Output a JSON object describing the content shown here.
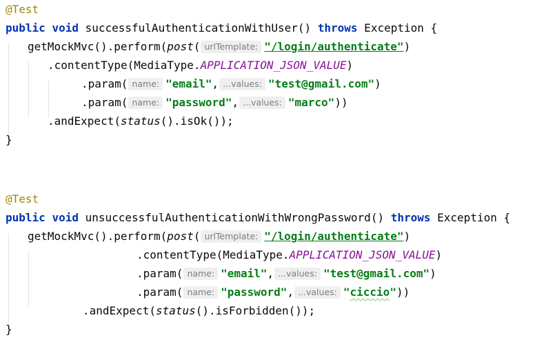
{
  "code": {
    "test1": {
      "annotation": "@Test",
      "kw_public": "public",
      "kw_void": "void",
      "method_sig": " successfulAuthenticationWithUser() ",
      "kw_throws": "throws",
      "sig_tail": " Exception {",
      "perform_pre": "getMockMvc().perform(",
      "post": "post",
      "paren": "(",
      "hint_url": "urlTemplate:",
      "url": "\"/login/authenticate\"",
      "close_paren": ")",
      "content_type_pre": ".contentType(MediaType.",
      "media_const": "APPLICATION_JSON_VALUE",
      "content_type_post": ")",
      "param1_pre": ".param(",
      "hint_name": "name:",
      "param1_name": "\"email\"",
      "comma": ",",
      "hint_values": "...values:",
      "param1_value": "\"test@gmail.com\"",
      "param1_post": ")",
      "param2_pre": ".param(",
      "param2_name": "\"password\"",
      "param2_value": "\"marco\"",
      "param2_post": "))",
      "expect_pre": ".andExpect(",
      "status": "status",
      "expect_post": "().isOk());",
      "closing_brace": "}"
    },
    "test2": {
      "annotation": "@Test",
      "kw_public": "public",
      "kw_void": "void",
      "method_sig": " unsuccessfulAuthenticationWithWrongPassword() ",
      "kw_throws": "throws",
      "sig_tail": " Exception {",
      "perform_pre": "getMockMvc().perform(",
      "post": "post",
      "paren": "(",
      "hint_url": "urlTemplate:",
      "url": "\"/login/authenticate\"",
      "close_paren": ")",
      "content_type_pre": ".contentType(MediaType.",
      "media_const": "APPLICATION_JSON_VALUE",
      "content_type_post": ")",
      "param1_pre": ".param(",
      "hint_name": "name:",
      "param1_name": "\"email\"",
      "comma": ",",
      "hint_values": "...values:",
      "param1_value": "\"test@gmail.com\"",
      "param1_post": ")",
      "param2_pre": ".param(",
      "param2_name": "\"password\"",
      "param2_value_open": "\"",
      "param2_value_word": "ciccio",
      "param2_value_close": "\"",
      "param2_post": "))",
      "expect_pre": ".andExpect(",
      "status": "status",
      "expect_post": "().isForbidden());",
      "closing_brace": "}"
    }
  },
  "colors": {
    "keyword": "#0033b3",
    "annotation": "#9e880d",
    "string": "#067d17",
    "constant": "#871094",
    "hint_bg": "#efefef",
    "hint_text": "#7d7d7d",
    "indent_guide": "#e3e3e3"
  }
}
